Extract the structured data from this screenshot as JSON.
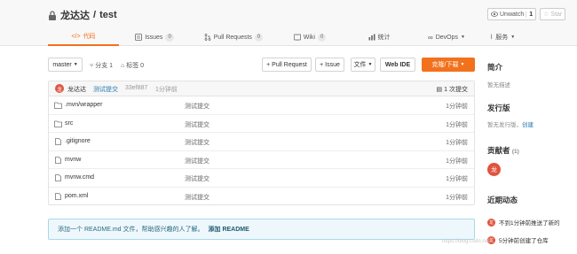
{
  "repo": {
    "owner": "龙达达",
    "separator": "/",
    "name": "test"
  },
  "watch": {
    "label": "Unwatch",
    "count": "1",
    "star_label": "Star"
  },
  "tabs": [
    {
      "label": "代码",
      "badge": ""
    },
    {
      "label": "Issues",
      "badge": "0"
    },
    {
      "label": "Pull Requests",
      "badge": "0"
    },
    {
      "label": "Wiki",
      "badge": "0"
    },
    {
      "label": "统计",
      "badge": ""
    },
    {
      "label": "DevOps",
      "badge": ""
    },
    {
      "label": "服务",
      "badge": ""
    }
  ],
  "toolbar": {
    "branch": "master",
    "branches": "分支 1",
    "tags": "标签 0",
    "pull_request": "+ Pull Request",
    "issue": "+ Issue",
    "file": "文件",
    "webide": "Web IDE",
    "clone": "克隆/下载"
  },
  "commit": {
    "avatar_char": "龙",
    "author": "龙达达",
    "message": "测试提交",
    "hash": "33ef887",
    "time": "1分钟前",
    "count": "1 次提交"
  },
  "files": [
    {
      "name": ".mvn/wrapper",
      "type": "folder",
      "message": "测试提交",
      "time": "1分钟前"
    },
    {
      "name": "src",
      "type": "folder",
      "message": "测试提交",
      "time": "1分钟前"
    },
    {
      "name": ".gitignore",
      "type": "file",
      "message": "测试提交",
      "time": "1分钟前"
    },
    {
      "name": "mvnw",
      "type": "file",
      "message": "测试提交",
      "time": "1分钟前"
    },
    {
      "name": "mvnw.cmd",
      "type": "file",
      "message": "测试提交",
      "time": "1分钟前"
    },
    {
      "name": "pom.xml",
      "type": "file",
      "message": "测试提交",
      "time": "1分钟前"
    }
  ],
  "readme": {
    "text": "添加一个 README.md 文件，帮助感兴趣的人了解。",
    "action": "添加 README"
  },
  "sidebar": {
    "intro_title": "简介",
    "intro_text": "暂无描述",
    "release_title": "发行版",
    "release_text": "暂无发行版，",
    "release_link": "创建",
    "contrib_title": "贡献者",
    "contrib_count": "(1)",
    "contrib_avatar": "龙",
    "activity_title": "近期动态",
    "activities": [
      {
        "avatar": "龙",
        "text": "不到1分钟前推送了新的"
      },
      {
        "avatar": "龙",
        "text": "5分钟前创建了仓库"
      }
    ]
  },
  "watermark": "https://blog.csdn.net/..."
}
